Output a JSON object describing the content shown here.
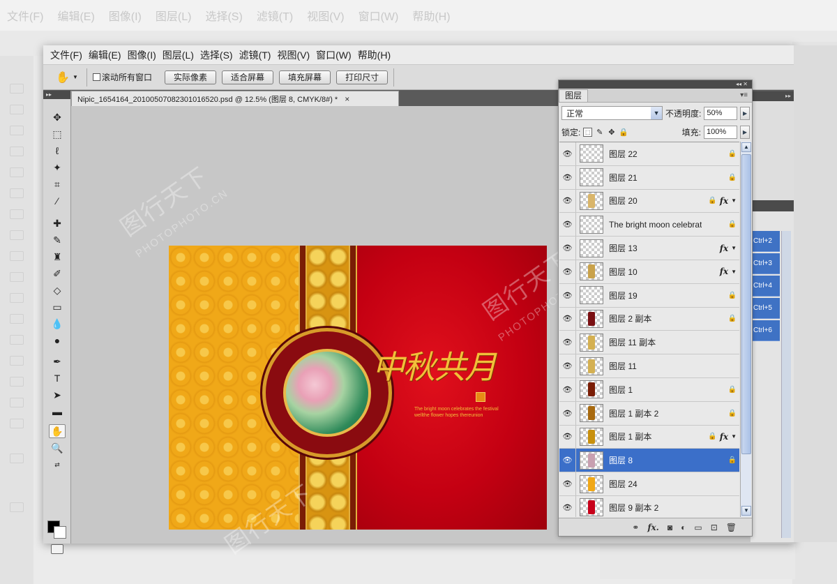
{
  "menu": [
    "文件(F)",
    "编辑(E)",
    "图像(I)",
    "图层(L)",
    "选择(S)",
    "滤镜(T)",
    "视图(V)",
    "窗口(W)",
    "帮助(H)"
  ],
  "options_bar": {
    "hand_icon": "hand-icon",
    "scroll_all_label": "滚动所有窗口",
    "buttons": [
      "实际像素",
      "适合屏幕",
      "填充屏幕",
      "打印尺寸"
    ]
  },
  "document": {
    "tab_title": "Nipic_1654164_20100507082301016520.psd @ 12.5% (图层 8, CMYK/8#) *",
    "close_glyph": "×"
  },
  "artwork": {
    "title_text": "中秋共月",
    "caption": "The bright moon celebrates the festival wellthe flower hopes thereunion"
  },
  "watermark": {
    "brand": "图行天下",
    "url": "PHOTOPHOTO.CN"
  },
  "layers_panel": {
    "tab_label": "图层",
    "blend_mode": "正常",
    "opacity_label": "不透明度:",
    "opacity_value": "50%",
    "lock_label": "锁定:",
    "fill_label": "填充:",
    "fill_value": "100%",
    "layers": [
      {
        "name": "图层 22",
        "lock": true,
        "fx": false,
        "thumb_color": ""
      },
      {
        "name": "图层 21",
        "lock": true,
        "fx": false,
        "thumb_color": ""
      },
      {
        "name": "图层 20",
        "lock": true,
        "fx": true,
        "thumb_color": "#d9b56a"
      },
      {
        "name": "The bright moon celebrates ...",
        "lock": true,
        "fx": false,
        "thumb_color": ""
      },
      {
        "name": "图层 13",
        "lock": false,
        "fx": true,
        "thumb_color": ""
      },
      {
        "name": "图层 10",
        "lock": false,
        "fx": true,
        "thumb_color": "#c9a24b"
      },
      {
        "name": "图层 19",
        "lock": true,
        "fx": false,
        "thumb_color": ""
      },
      {
        "name": "图层 2 副本",
        "lock": true,
        "fx": false,
        "thumb_color": "#7a0f12"
      },
      {
        "name": "图层 11 副本",
        "lock": false,
        "fx": false,
        "thumb_color": "#d4b052"
      },
      {
        "name": "图层 11",
        "lock": false,
        "fx": false,
        "thumb_color": "#d4b052"
      },
      {
        "name": "图层 1",
        "lock": true,
        "fx": false,
        "thumb_color": "#7a1d05"
      },
      {
        "name": "图层 1 副本 2",
        "lock": true,
        "fx": false,
        "thumb_color": "#a86a10"
      },
      {
        "name": "图层 1 副本",
        "lock": true,
        "fx": true,
        "thumb_color": "#c8900e"
      },
      {
        "name": "图层 8",
        "lock": true,
        "fx": false,
        "thumb_color": "#c8a0b0",
        "selected": true
      },
      {
        "name": "图层 24",
        "lock": false,
        "fx": false,
        "thumb_color": "#f0a818"
      },
      {
        "name": "图层 9 副本 2",
        "lock": false,
        "fx": false,
        "thumb_color": "#c8001a"
      }
    ],
    "footer_icons": [
      "link-icon",
      "fx-icon",
      "mask-icon",
      "adjustment-icon",
      "group-icon",
      "new-layer-icon",
      "trash-icon"
    ]
  },
  "actions_panel": {
    "shortcuts": [
      "Ctrl+2",
      "Ctrl+3",
      "Ctrl+4",
      "Ctrl+5",
      "Ctrl+6"
    ]
  },
  "colors": {
    "selected_row": "#3b6fc9",
    "canvas_bg": "#c7c7c7"
  }
}
